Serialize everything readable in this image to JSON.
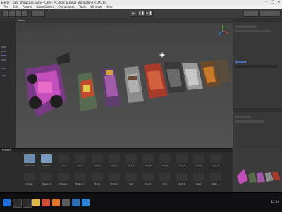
{
  "window": {
    "title": "Editor - cars_showcase.unity - Cars - PC, Mac & Linux Standalone <DX11>"
  },
  "menu": [
    "File",
    "Edit",
    "Assets",
    "GameObject",
    "Component",
    "Tools",
    "Window",
    "Help"
  ],
  "toolbar": {
    "play": "▶",
    "pause": "❚❚",
    "step": "▶❚"
  },
  "scene": {
    "tab_label": "Scene",
    "gizmo_label": "Persp"
  },
  "assets": {
    "panel_title": "Project",
    "row1": [
      "Materials",
      "Prefabs",
      "Car",
      "Car_1",
      "Car_2",
      "Car_3",
      "Car_4",
      "Car_5",
      "Car_6",
      "Car_7",
      "Car_8",
      "Car_9"
    ],
    "row2": [
      "Buggy",
      "Buggy_1",
      "Muscle",
      "Muscle_1",
      "Truck",
      "Truck_1",
      "Van",
      "Van_1",
      "Rod",
      "Rod_1",
      "Rally",
      "Rally_1"
    ]
  },
  "taskbar": {
    "icons": [
      "windows",
      "search",
      "taskview",
      "explorer",
      "chrome",
      "firefox",
      "unity",
      "store",
      "mail"
    ],
    "time": "12:00"
  }
}
